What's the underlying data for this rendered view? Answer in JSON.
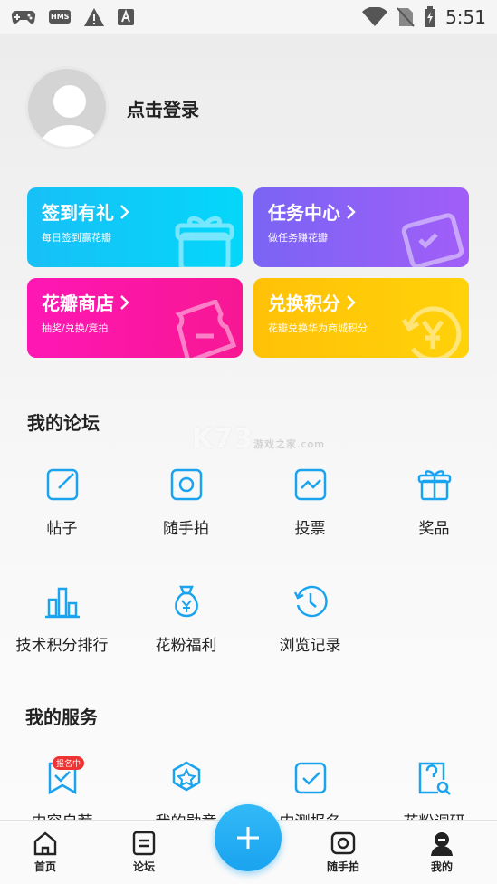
{
  "status_bar": {
    "time": "5:51",
    "hms_label": "HMS",
    "icons": [
      "gamepad-icon",
      "hms-icon",
      "warning-icon",
      "a-icon",
      "wifi-icon",
      "no-sim-icon",
      "battery-charging-icon"
    ]
  },
  "profile": {
    "login_label": "点击登录"
  },
  "cards": [
    {
      "title": "签到有礼",
      "subtitle": "每日签到赢花瓣",
      "icon": "gift-icon"
    },
    {
      "title": "任务中心",
      "subtitle": "做任务赚花瓣",
      "icon": "task-icon"
    },
    {
      "title": "花瓣商店",
      "subtitle": "抽奖/兑换/竞拍",
      "icon": "ticket-icon"
    },
    {
      "title": "兑换积分",
      "subtitle": "花瓣兑换华为商城积分",
      "icon": "exchange-icon"
    }
  ],
  "forum": {
    "title": "我的论坛",
    "items": [
      {
        "label": "帖子",
        "icon": "edit-post-icon"
      },
      {
        "label": "随手拍",
        "icon": "camera-icon"
      },
      {
        "label": "投票",
        "icon": "vote-chart-icon"
      },
      {
        "label": "奖品",
        "icon": "prize-gift-icon"
      },
      {
        "label": "技术积分排行",
        "icon": "ranking-bars-icon"
      },
      {
        "label": "花粉福利",
        "icon": "money-bag-icon"
      },
      {
        "label": "浏览记录",
        "icon": "history-clock-icon"
      }
    ]
  },
  "services": {
    "title": "我的服务",
    "badge": "报名中",
    "items": [
      {
        "label": "内容自荐",
        "icon": "recommend-icon"
      },
      {
        "label": "我的勋章",
        "icon": "medal-icon"
      },
      {
        "label": "内测报名",
        "icon": "beta-signup-icon"
      },
      {
        "label": "花粉调研",
        "icon": "survey-icon"
      }
    ]
  },
  "watermark": {
    "brand": "K73",
    "sub": "游戏之家",
    "domain": ".com"
  },
  "bottom_nav": {
    "items": [
      {
        "label": "首页",
        "icon": "home-icon"
      },
      {
        "label": "论坛",
        "icon": "forum-icon"
      },
      {
        "label": "随手拍",
        "icon": "camera-icon"
      },
      {
        "label": "我的",
        "icon": "profile-icon"
      }
    ],
    "fab_icon": "plus-icon"
  },
  "colors": {
    "accent": "#1aa3ef",
    "icon_blue": "#1aa3ef"
  }
}
